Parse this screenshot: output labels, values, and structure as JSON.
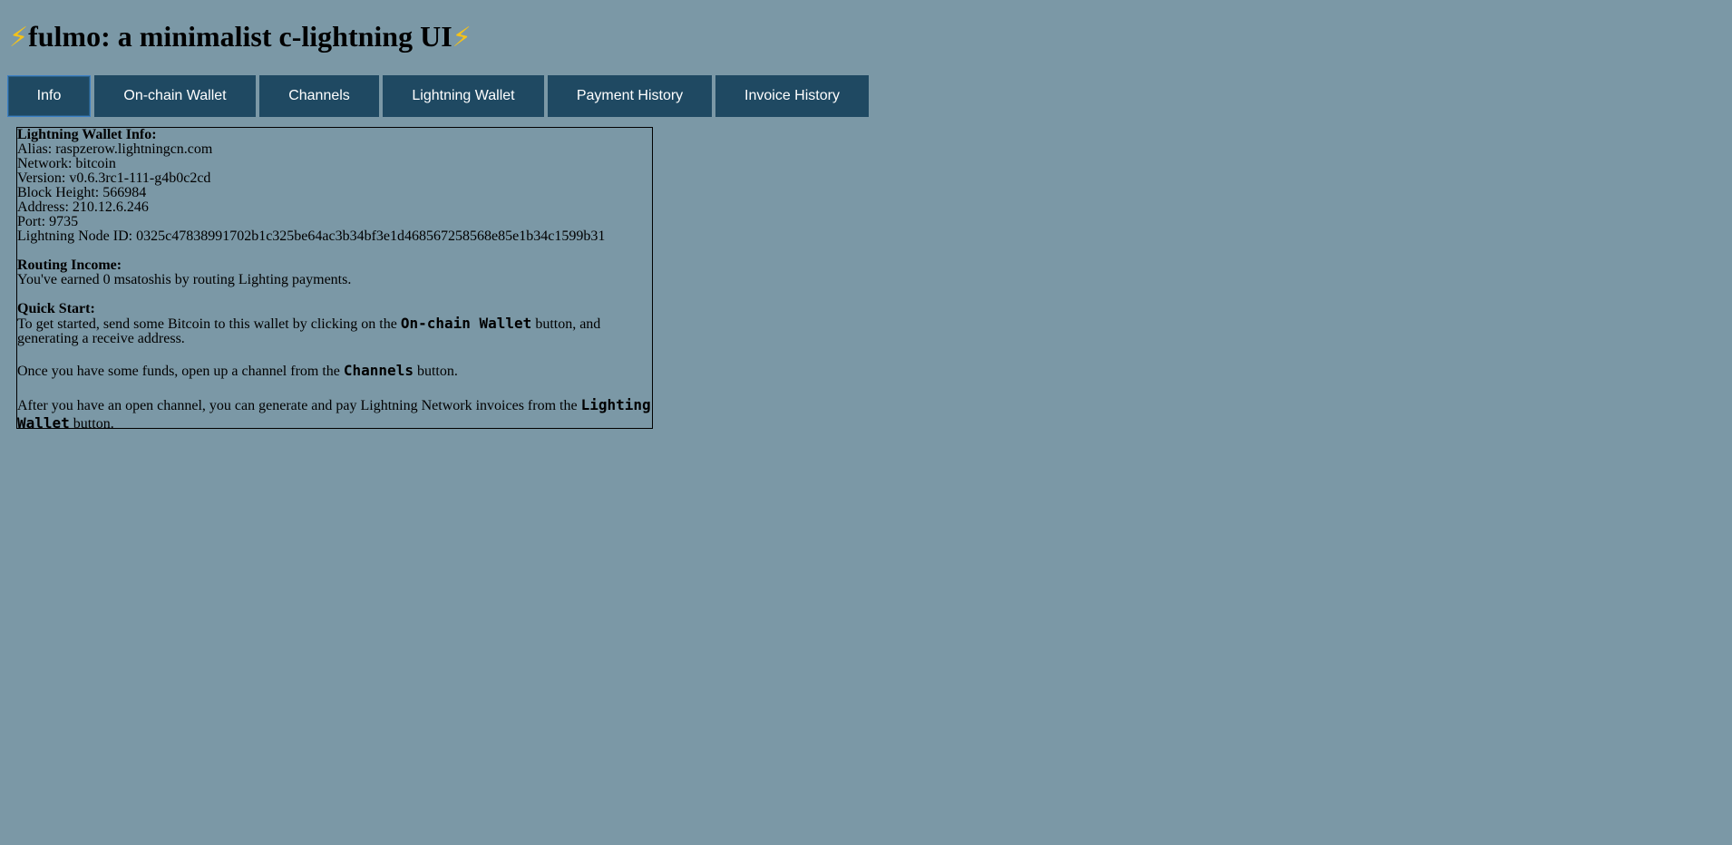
{
  "header": {
    "title": "fulmo: a minimalist c-lightning UI",
    "left_icon": "lightning-bolt",
    "right_icon": "lightning-bolt",
    "bolt_glyph": "⚡"
  },
  "tabs": [
    {
      "label": "Info",
      "active": true
    },
    {
      "label": "On-chain Wallet",
      "active": false
    },
    {
      "label": "Channels",
      "active": false
    },
    {
      "label": "Lightning Wallet",
      "active": false
    },
    {
      "label": "Payment History",
      "active": false
    },
    {
      "label": "Invoice History",
      "active": false
    }
  ],
  "info": {
    "heading": "Lightning Wallet Info:",
    "alias": "Alias: raspzerow.lightningcn.com",
    "network": "Network: bitcoin",
    "version": "Version: v0.6.3rc1-111-g4b0c2cd",
    "block_height": "Block Height: 566984",
    "address": "Address: 210.12.6.246",
    "port": "Port: 9735",
    "node_id": "Lightning Node ID: 0325c47838991702b1c325be64ac3b34bf3e1d468567258568e85e1b34c1599b31"
  },
  "routing": {
    "heading": "Routing Income:",
    "text": "You've earned 0 msatoshis by routing Lighting payments."
  },
  "quickstart": {
    "heading": "Quick Start:",
    "p1_before": "To get started, send some Bitcoin to this wallet by clicking on the ",
    "p1_code": "On-chain Wallet",
    "p1_after": " button, and generating a receive address.",
    "p2_before": "Once you have some funds, open up a channel from the ",
    "p2_code": "Channels",
    "p2_after": " button.",
    "p3_before": "After you have an open channel, you can generate and pay Lightning Network invoices from the ",
    "p3_code": "Lighting Wallet",
    "p3_after": " button."
  },
  "colors": {
    "background": "#7b98a6",
    "tab_background": "#1f4962",
    "tab_text": "#ffffff",
    "bolt": "#f4c21a"
  }
}
